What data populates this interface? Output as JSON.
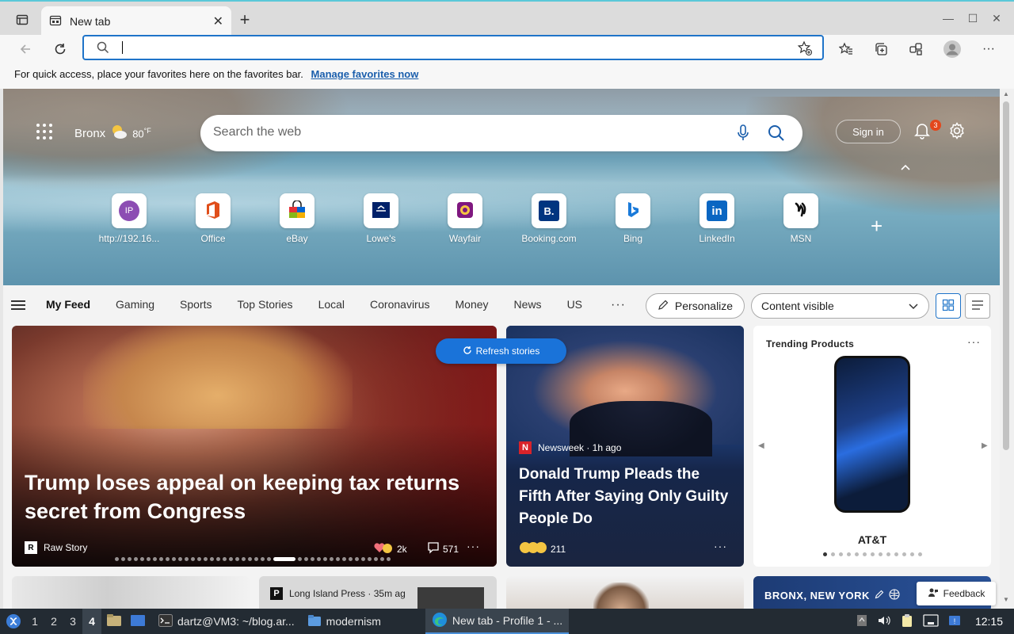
{
  "browser": {
    "tab": {
      "title": "New tab"
    },
    "address": {
      "value": ""
    },
    "favorites_bar": {
      "text": "For quick access, place your favorites here on the favorites bar.",
      "link": "Manage favorites now"
    }
  },
  "ntp": {
    "weather": {
      "location": "Bronx",
      "temp": "80",
      "unit": "°F"
    },
    "search_placeholder": "Search the web",
    "sign_in": "Sign in",
    "notification_count": "3",
    "tiles": [
      {
        "label": "http://192.16...",
        "icon": "ip-icon"
      },
      {
        "label": "Office",
        "icon": "office-icon"
      },
      {
        "label": "eBay",
        "icon": "ebay-icon"
      },
      {
        "label": "Lowe's",
        "icon": "lowes-icon"
      },
      {
        "label": "Wayfair",
        "icon": "wayfair-icon"
      },
      {
        "label": "Booking.com",
        "icon": "booking-icon"
      },
      {
        "label": "Bing",
        "icon": "bing-icon"
      },
      {
        "label": "LinkedIn",
        "icon": "linkedin-icon"
      },
      {
        "label": "MSN",
        "icon": "msn-icon"
      }
    ],
    "ip_badge": "IP",
    "booking_badge": "B.",
    "linkedin_badge": "in"
  },
  "nav": {
    "items": [
      "My Feed",
      "Gaming",
      "Sports",
      "Top Stories",
      "Local",
      "Coronavirus",
      "Money",
      "News",
      "US"
    ],
    "personalize": "Personalize",
    "content_visible": "Content visible"
  },
  "feed": {
    "refresh": "Refresh stories",
    "main": {
      "title": "Trump loses appeal on keeping tax returns secret from Congress",
      "source": "Raw Story",
      "source_badge": "R",
      "reactions": "2k",
      "comments": "571"
    },
    "card2": {
      "source": "Newsweek · 1h ago",
      "source_badge": "N",
      "title": "Donald Trump Pleads the Fifth After Saying Only Guilty People Do",
      "reactions": "211"
    },
    "trending": {
      "title": "Trending Products",
      "product": "AT&T"
    },
    "bottom2": {
      "source": "Long Island Press · 35m ag",
      "source_badge": "P"
    },
    "bottom4": {
      "title": "BRONX, NEW YORK"
    },
    "feedback": "Feedback"
  },
  "taskbar": {
    "workspaces": [
      "1",
      "2",
      "3",
      "4"
    ],
    "active_workspace": "4",
    "tasks": [
      {
        "label": "dartz@VM3: ~/blog.ar..."
      },
      {
        "label": "modernism"
      },
      {
        "label": "New tab - Profile 1 - ..."
      }
    ],
    "clock": "12:15"
  }
}
